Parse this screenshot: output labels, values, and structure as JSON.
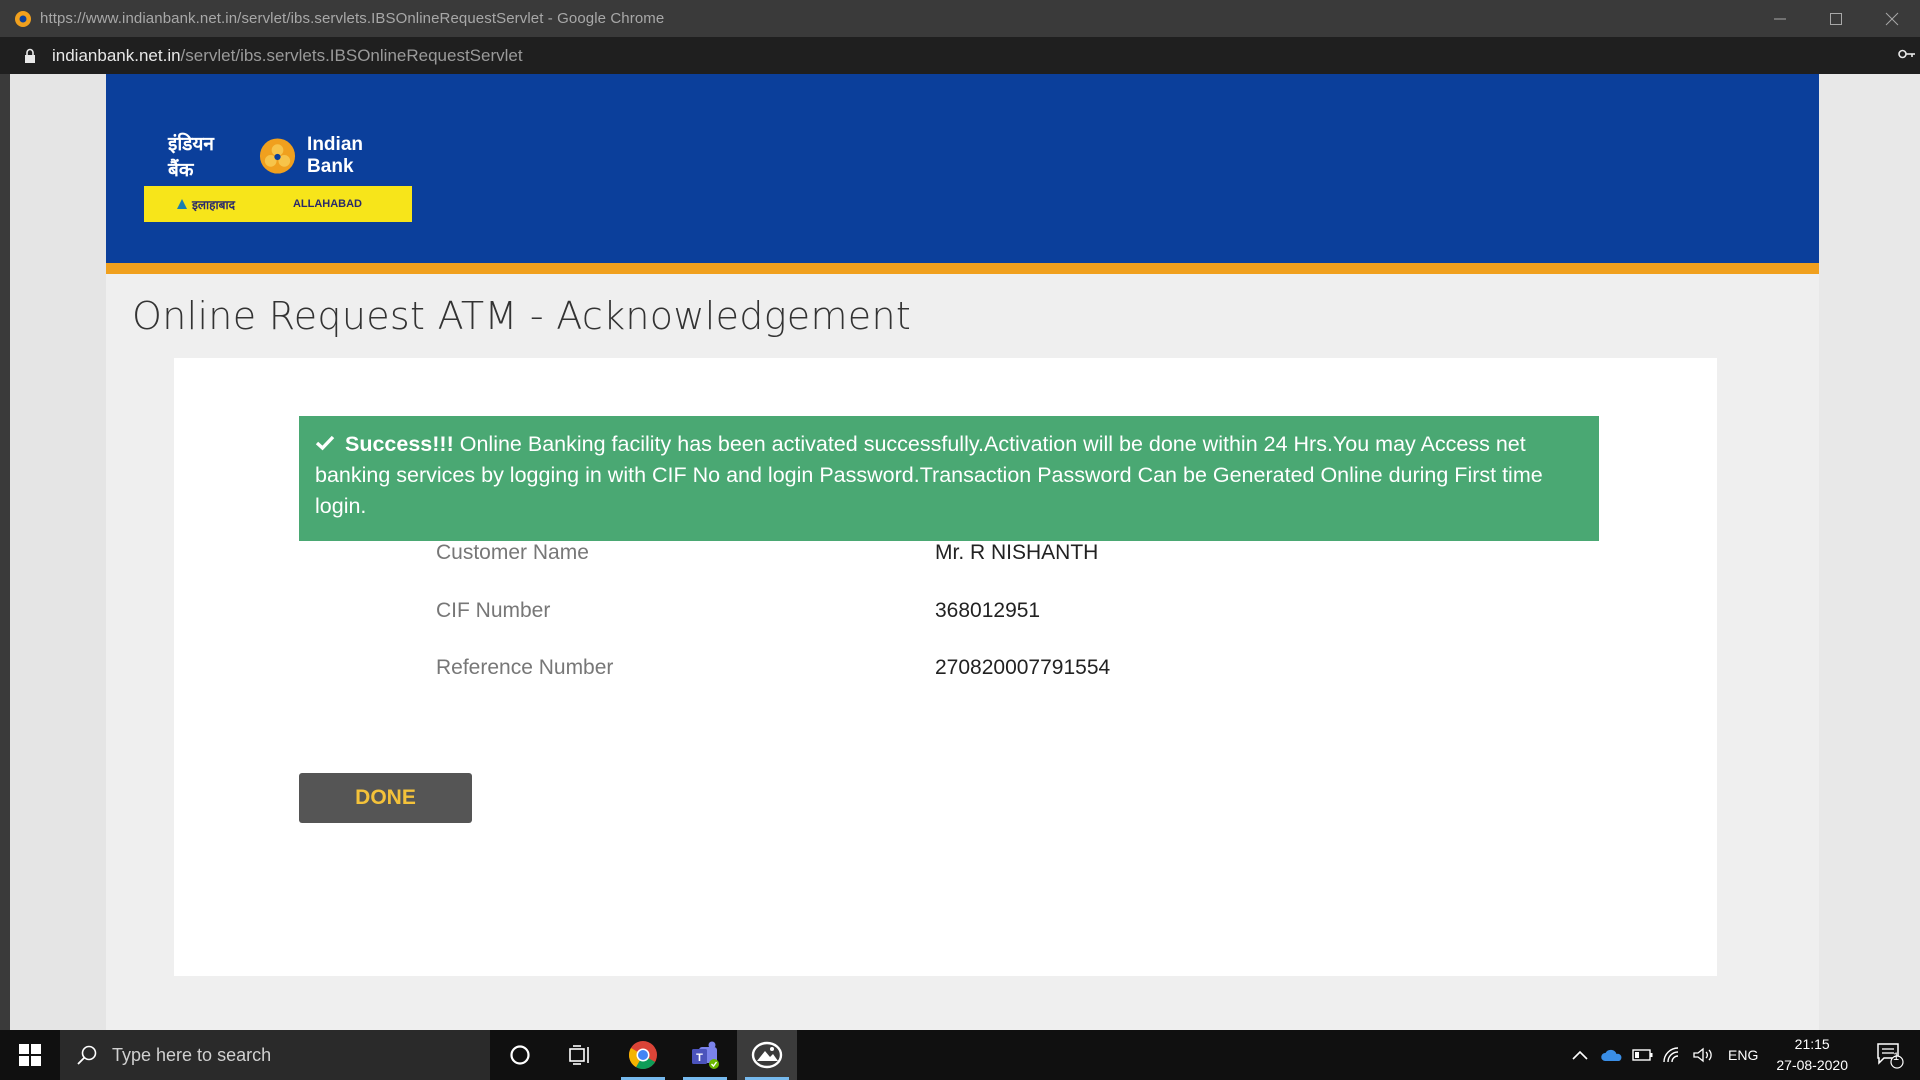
{
  "window": {
    "title": "https://www.indianbank.net.in/servlet/ibs.servlets.IBSOnlineRequestServlet - Google Chrome",
    "url_host": "indianbank.net.in",
    "url_path": "/servlet/ibs.servlets.IBSOnlineRequestServlet"
  },
  "logo": {
    "hindi_name": "इंडियन बैंक",
    "english_name": "Indian Bank",
    "band_hindi": "इलाहाबाद",
    "band_english": "ALLAHABAD"
  },
  "page": {
    "title": "Online Request ATM - Acknowledgement"
  },
  "alert": {
    "strong": "Success!!!",
    "message": "Online Banking facility has been activated successfully.Activation will be done within 24 Hrs.You may Access net banking services by logging in with CIF No and login Password.Transaction Password Can be Generated Online during First time login."
  },
  "details": [
    {
      "label": "Customer Name",
      "value": "Mr. R NISHANTH"
    },
    {
      "label": "CIF Number",
      "value": "368012951"
    },
    {
      "label": "Reference Number",
      "value": "270820007791554"
    }
  ],
  "done_label": "DONE",
  "taskbar": {
    "search_placeholder": "Type here to search",
    "language": "ENG",
    "time": "21:15",
    "date": "27-08-2020",
    "notification_count": "1"
  },
  "colors": {
    "header_blue": "#0b3f9b",
    "stripe_orange": "#f0a01e",
    "success_green": "#4aa873",
    "button_text_yellow": "#f4c23a"
  }
}
